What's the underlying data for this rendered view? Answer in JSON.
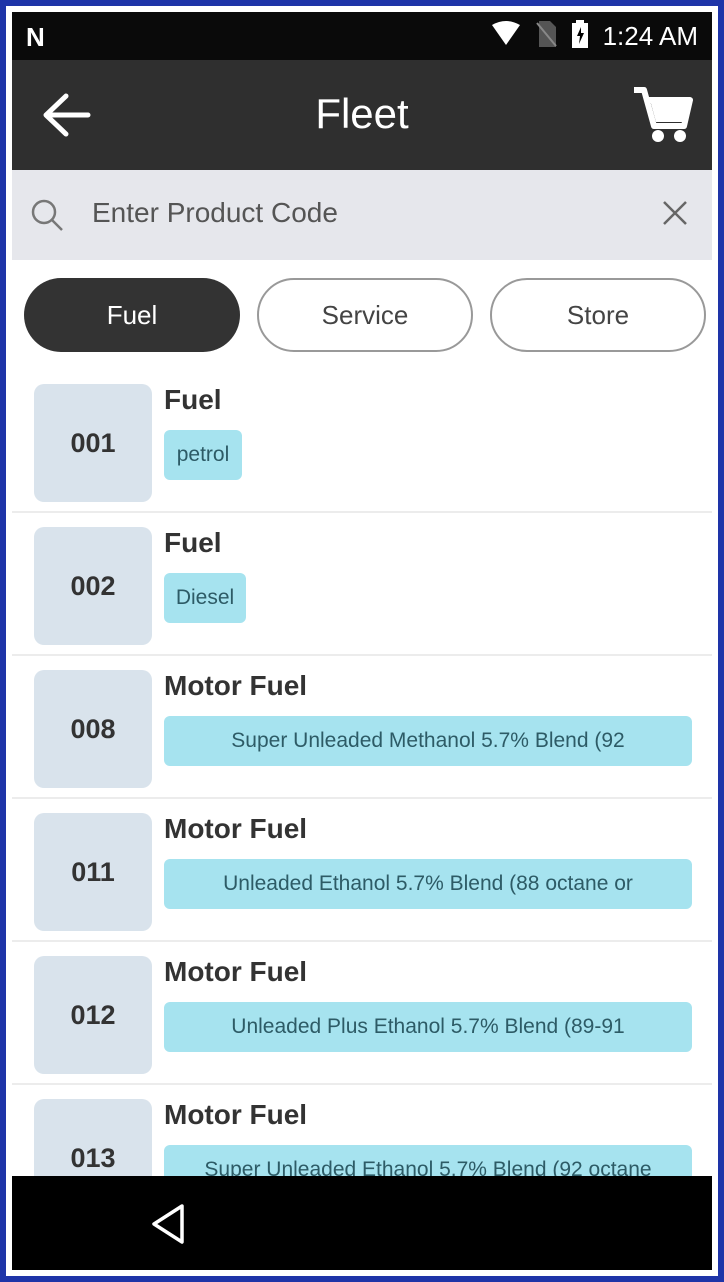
{
  "status_bar": {
    "carrier_icon": "N",
    "icons": [
      "wifi-icon",
      "no-sim-icon",
      "battery-icon"
    ],
    "time": "1:24 AM"
  },
  "app_bar": {
    "title": "Fleet",
    "back_icon": "arrow-left-icon",
    "cart_icon": "cart-icon"
  },
  "search": {
    "placeholder": "Enter Product Code",
    "value": "",
    "search_icon": "search-icon",
    "clear_icon": "close-icon"
  },
  "tabs": [
    {
      "label": "Fuel",
      "active": true
    },
    {
      "label": "Service",
      "active": false
    },
    {
      "label": "Store",
      "active": false
    }
  ],
  "products": [
    {
      "code": "001",
      "title": "Fuel",
      "tag": "petrol"
    },
    {
      "code": "002",
      "title": "Fuel",
      "tag": "Diesel"
    },
    {
      "code": "008",
      "title": "Motor Fuel",
      "tag": "Super Unleaded Methanol 5.7% Blend (92"
    },
    {
      "code": "011",
      "title": "Motor Fuel",
      "tag": "Unleaded Ethanol 5.7% Blend (88 octane or"
    },
    {
      "code": "012",
      "title": "Motor Fuel",
      "tag": "Unleaded Plus Ethanol 5.7% Blend (89-91"
    },
    {
      "code": "013",
      "title": "Motor Fuel",
      "tag": "Super Unleaded Ethanol 5.7% Blend (92 octane"
    }
  ],
  "nav_bar": {
    "back_icon": "triangle-back-icon"
  },
  "colors": {
    "app_bar": "#2f2f2f",
    "search_bg": "#e6e7ec",
    "tab_active": "#333333",
    "code_box": "#d9e3ec",
    "tag_bg": "#a6e3ef",
    "frame": "#1e34a8"
  }
}
